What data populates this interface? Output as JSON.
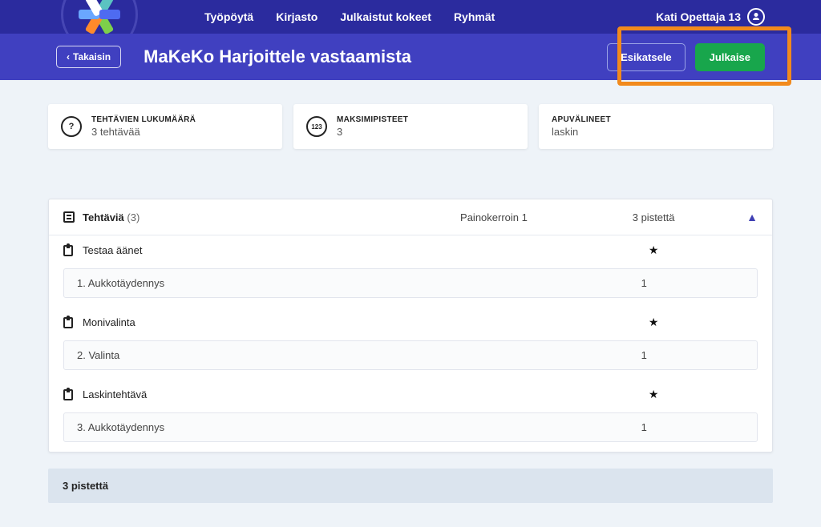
{
  "nav": {
    "items": [
      "Työpöytä",
      "Kirjasto",
      "Julkaistut kokeet",
      "Ryhmät"
    ],
    "user_name": "Kati Opettaja 13"
  },
  "subbar": {
    "back_label": "Takaisin",
    "page_title": "MaKeKo Harjoittele vastaamista",
    "preview_label": "Esikatsele",
    "publish_label": "Julkaise"
  },
  "cards": {
    "task_count": {
      "label": "TEHTÄVIEN LUKUMÄÄRÄ",
      "value": "3 tehtävää",
      "icon": "?"
    },
    "max_points": {
      "label": "MAKSIMIPISTEET",
      "value": "3",
      "icon": "123"
    },
    "tools": {
      "label": "APUVÄLINEET",
      "value": "laskin"
    }
  },
  "panel": {
    "header": {
      "title": "Tehtäviä",
      "count": "(3)",
      "multiplier": "Painokerroin 1",
      "points": "3 pistettä"
    },
    "groups": [
      {
        "name": "Testaa äänet",
        "star": "★",
        "items": [
          {
            "label": "1. Aukkotäydennys",
            "points": "1"
          }
        ]
      },
      {
        "name": "Monivalinta",
        "star": "★",
        "items": [
          {
            "label": "2. Valinta",
            "points": "1"
          }
        ]
      },
      {
        "name": "Laskintehtävä",
        "star": "★",
        "items": [
          {
            "label": "3. Aukkotäydennys",
            "points": "1"
          }
        ]
      }
    ],
    "total": "3 pistettä"
  }
}
